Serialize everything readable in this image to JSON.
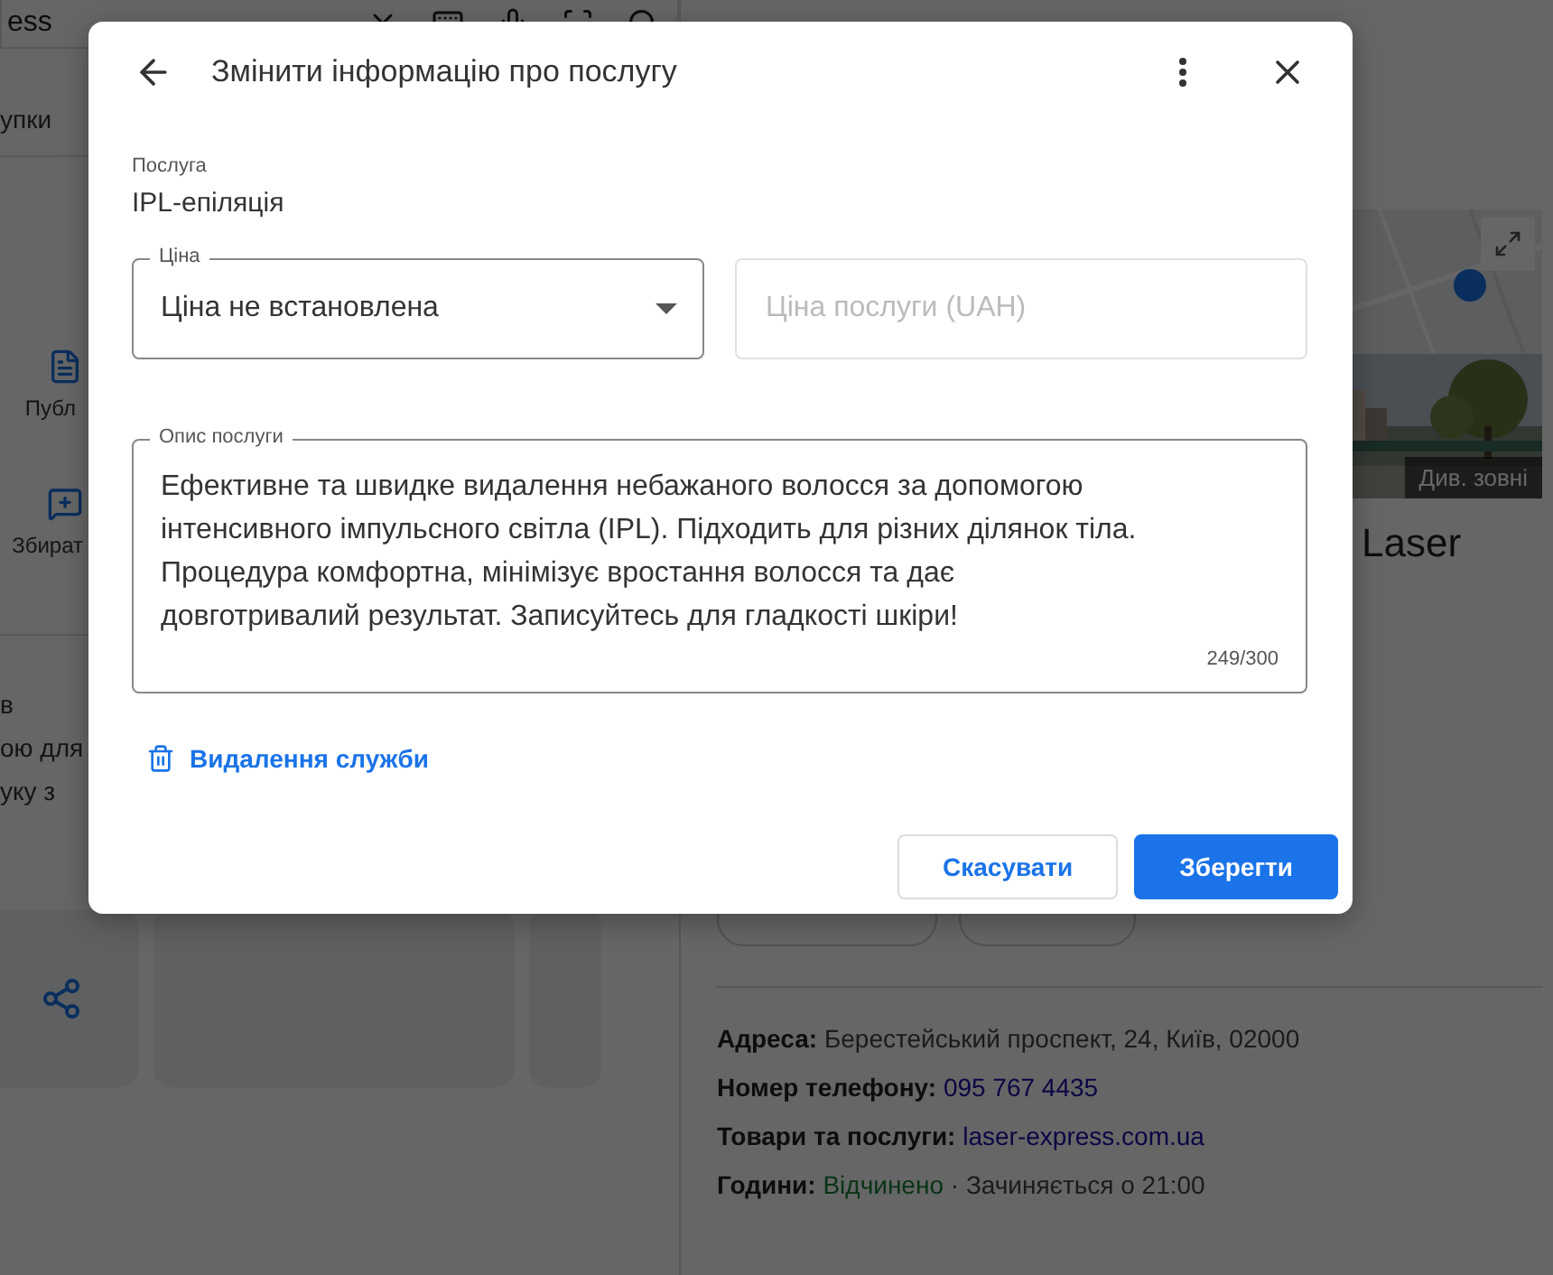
{
  "background": {
    "search_text": "ess",
    "left_panel": {
      "tab": "упки",
      "actions": [
        {
          "label": "Публ"
        },
        {
          "label": "Збират"
        }
      ],
      "section_title": "в",
      "section_lines": [
        "ою для",
        "уку з"
      ]
    },
    "right_panel": {
      "photo_label": "Див. зовні",
      "business_name": "Laser",
      "info": [
        {
          "kind": "text",
          "label": "Адреса:",
          "value": "Берестейський проспект, 24, Київ, 02000"
        },
        {
          "kind": "link",
          "label": "Номер телефону:",
          "value": "095 767 4435"
        },
        {
          "kind": "link",
          "label": "Товари та послуги:",
          "value": "laser-express.com.ua"
        },
        {
          "kind": "hours",
          "label": "Години:",
          "status": "Відчинено",
          "value": "· Зачиняється о 21:00"
        }
      ]
    }
  },
  "dialog": {
    "title": "Змінити інформацію про послугу",
    "service": {
      "label": "Послуга",
      "value": "IPL-епіляція"
    },
    "price": {
      "label": "Ціна",
      "value": "Ціна не встановлена"
    },
    "price_input": {
      "placeholder": "Ціна послуги (UAH)"
    },
    "description": {
      "label": "Опис послуги",
      "value": "Ефективне та швидке видалення небажаного волосся за допомогою інтенсивного імпульсного світла (IPL). Підходить для різних ділянок тіла. Процедура комфортна, мінімізує вростання волосся та дає довготривалий результат. Записуйтесь для гладкості шкіри!",
      "counter": "249/300"
    },
    "delete_link": "Видалення служби",
    "buttons": [
      {
        "kind": "secondary",
        "label": "Скасувати"
      },
      {
        "kind": "primary",
        "label": "Зберегти"
      }
    ]
  }
}
